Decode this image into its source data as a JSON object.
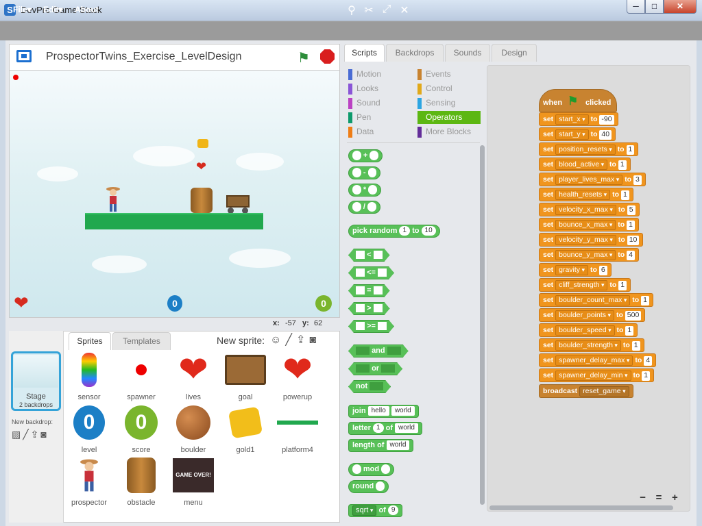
{
  "window": {
    "title": "DevPro Game Stack",
    "app_icon": "S",
    "minimize": "─",
    "maximize": "□",
    "close": "✕"
  },
  "menubar": {
    "file": "File▾",
    "edit": "Edit▾",
    "about": "About",
    "tools": [
      "duplicate-icon",
      "delete-icon",
      "grow-icon",
      "shrink-icon"
    ]
  },
  "stage": {
    "title": "ProspectorTwins_Exercise_LevelDesign",
    "level_counter": "0",
    "score_counter": "0",
    "coords": {
      "x_label": "x:",
      "x": "-57",
      "y_label": "y:",
      "y": "62"
    }
  },
  "sprite_pane": {
    "tabs": [
      "Sprites",
      "Templates"
    ],
    "new_sprite_label": "New sprite:",
    "stage_label": "Stage",
    "stage_backdrops": "2 backdrops",
    "new_backdrop_label": "New backdrop:",
    "sprites": [
      "sensor",
      "spawner",
      "lives",
      "goal",
      "powerup",
      "level",
      "score",
      "boulder",
      "gold1",
      "platform4",
      "prospector",
      "obstacle",
      "menu"
    ],
    "menu_thumb_text": "GAME OVER!"
  },
  "editor_tabs": [
    "Scripts",
    "Backdrops",
    "Sounds",
    "Design"
  ],
  "categories": {
    "left": [
      {
        "label": "Motion",
        "color": "#4a6cd4"
      },
      {
        "label": "Looks",
        "color": "#8a55d7"
      },
      {
        "label": "Sound",
        "color": "#bb42c3"
      },
      {
        "label": "Pen",
        "color": "#0e9a6c"
      },
      {
        "label": "Data",
        "color": "#ee7d16"
      }
    ],
    "right": [
      {
        "label": "Events",
        "color": "#c88330"
      },
      {
        "label": "Control",
        "color": "#e1a91a"
      },
      {
        "label": "Sensing",
        "color": "#2ca5e2"
      },
      {
        "label": "Operators",
        "color": "#5cb712"
      },
      {
        "label": "More Blocks",
        "color": "#632d99"
      }
    ],
    "selected": "Operators"
  },
  "palette": {
    "plus": "+",
    "minus": "-",
    "times": "*",
    "divide": "/",
    "pick_random": "pick random",
    "pick_from": "1",
    "pick_to_word": "to",
    "pick_to": "10",
    "lt": "<",
    "le": "<=",
    "eq": "=",
    "gt": ">",
    "ge": ">=",
    "and": "and",
    "or": "or",
    "not": "not",
    "join": "join",
    "join_a": "hello",
    "join_b": "world",
    "letter": "letter",
    "letter_n": "1",
    "letter_of": "of",
    "letter_s": "world",
    "length": "length",
    "length_of": "of",
    "length_s": "world",
    "mod": "mod",
    "round": "round",
    "sqrt": "sqrt",
    "sqrt_of": "of",
    "sqrt_n": "9"
  },
  "script": {
    "hat_when": "when",
    "hat_clicked": "clicked",
    "set_word": "set",
    "to_word": "to",
    "sets": [
      {
        "var": "start_x",
        "value": "-90"
      },
      {
        "var": "start_y",
        "value": "40"
      },
      {
        "var": "position_resets",
        "value": "1"
      },
      {
        "var": "blood_active",
        "value": "1"
      },
      {
        "var": "player_lives_max",
        "value": "3"
      },
      {
        "var": "health_resets",
        "value": "1"
      },
      {
        "var": "velocity_x_max",
        "value": "5"
      },
      {
        "var": "bounce_x_max",
        "value": "1"
      },
      {
        "var": "velocity_y_max",
        "value": "10"
      },
      {
        "var": "bounce_y_max",
        "value": "4"
      },
      {
        "var": "gravity",
        "value": "6"
      },
      {
        "var": "cliff_strength",
        "value": "1"
      },
      {
        "var": "boulder_count_max",
        "value": "1"
      },
      {
        "var": "boulder_points",
        "value": "500"
      },
      {
        "var": "boulder_speed",
        "value": "1"
      },
      {
        "var": "boulder_strength",
        "value": "1"
      },
      {
        "var": "spawner_delay_max",
        "value": "4"
      },
      {
        "var": "spawner_delay_min",
        "value": "1"
      }
    ],
    "broadcast_word": "broadcast",
    "broadcast_msg": "reset_game"
  },
  "zoom": {
    "out": "−",
    "reset": "=",
    "in": "+"
  }
}
